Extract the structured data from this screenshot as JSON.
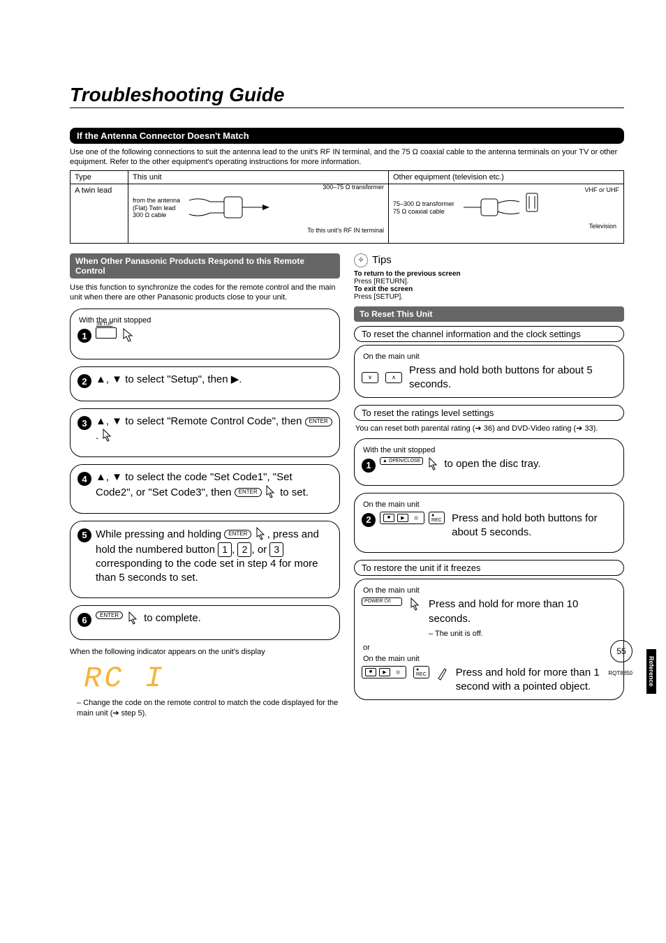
{
  "page_title": "Troubleshooting Guide",
  "section_antenna_title": "If the Antenna Connector Doesn't Match",
  "antenna_intro": "Use one of the following connections to suit the antenna lead to the unit's RF IN terminal, and the 75 Ω coaxial cable to the antenna terminals on your TV or other equipment. Refer to the other equipment's operating instructions for more information.",
  "table": {
    "h_type": "Type",
    "h_this_unit": "This unit",
    "h_other": "Other equipment (television etc.)",
    "row_label": "A twin lead",
    "this_unit_lines": [
      "from the antenna",
      "(Flat) Twin lead",
      "300 Ω cable"
    ],
    "this_unit_labels": [
      "300–75 Ω transformer",
      "To this unit's RF IN terminal"
    ],
    "other_lines": [
      "75–300 Ω transformer",
      "75 Ω coaxial cable"
    ],
    "other_labels": [
      "VHF or UHF",
      "Television"
    ]
  },
  "section_remote_title": "When Other Panasonic Products Respond to this Remote Control",
  "remote_intro": "Use this function to synchronize the codes for the remote control and the main unit when there are other Panasonic products close to your unit.",
  "steps_caption_1": "With the unit stopped",
  "remote_setup_label": "SETUP",
  "step2": "▲, ▼ to select \"Setup\", then ▶.",
  "step3_a": "▲, ▼ to select \"Remote Control Code\", then ",
  "step3_b": ".",
  "step4_a": "▲, ▼ to select the code \"Set Code1\", \"Set Code2\", or \"Set Code3\", then ",
  "step4_b": " to set.",
  "step5_a": "While pressing and holding ",
  "step5_b": ", press and hold the numbered button ",
  "step5_c": ", ",
  "step5_d": ", or ",
  "step5_e": " corresponding to the code set in step 4 for more than 5 seconds to set.",
  "step6": " to complete.",
  "enter_label": "ENTER",
  "num1": "1",
  "num2": "2",
  "num3": "3",
  "indicator_line": "When the following indicator appears on the unit's display",
  "rc_display": "RC  I",
  "indicator_note": "– Change the code on the remote control to match the code displayed for the main unit (➔ step 5).",
  "tips_title": "Tips",
  "tips_return_head": "To return to the previous screen",
  "tips_return_body": "Press [RETURN].",
  "tips_exit_head": "To exit the screen",
  "tips_exit_body": "Press [SETUP].",
  "reset_title": "To Reset This Unit",
  "reset1_head": "To reset the channel information and the clock settings",
  "reset1_caption": "On the main unit",
  "reset1_body": "Press and hold both buttons for about 5 seconds.",
  "reset2_head": "To reset the ratings level settings",
  "reset2_intro": "You can reset both parental rating (➔ 36) and DVD-Video rating (➔ 33).",
  "reset2_cap1": "With the unit stopped",
  "reset2_step1": " to open the disc tray.",
  "openclose_label": "▲ OPEN/CLOSE",
  "reset2_cap2": "On the main unit",
  "reset2_step2": "Press and hold both buttons for about 5 seconds.",
  "rec_label": "● REC",
  "reset3_head": "To restore the unit if it freezes",
  "reset3_cap1": "On the main unit",
  "reset3_body1": "Press and hold for more than 10 seconds.",
  "power_label": "POWER ⏻/I",
  "reset3_sub": "– The unit is off.",
  "reset3_or": "or",
  "reset3_cap2": "On the main unit",
  "reset3_body2": "Press and hold for more than 1 second with a pointed object.",
  "side_tab": "Reference",
  "page_number": "55",
  "footer_code": "RQT8850"
}
